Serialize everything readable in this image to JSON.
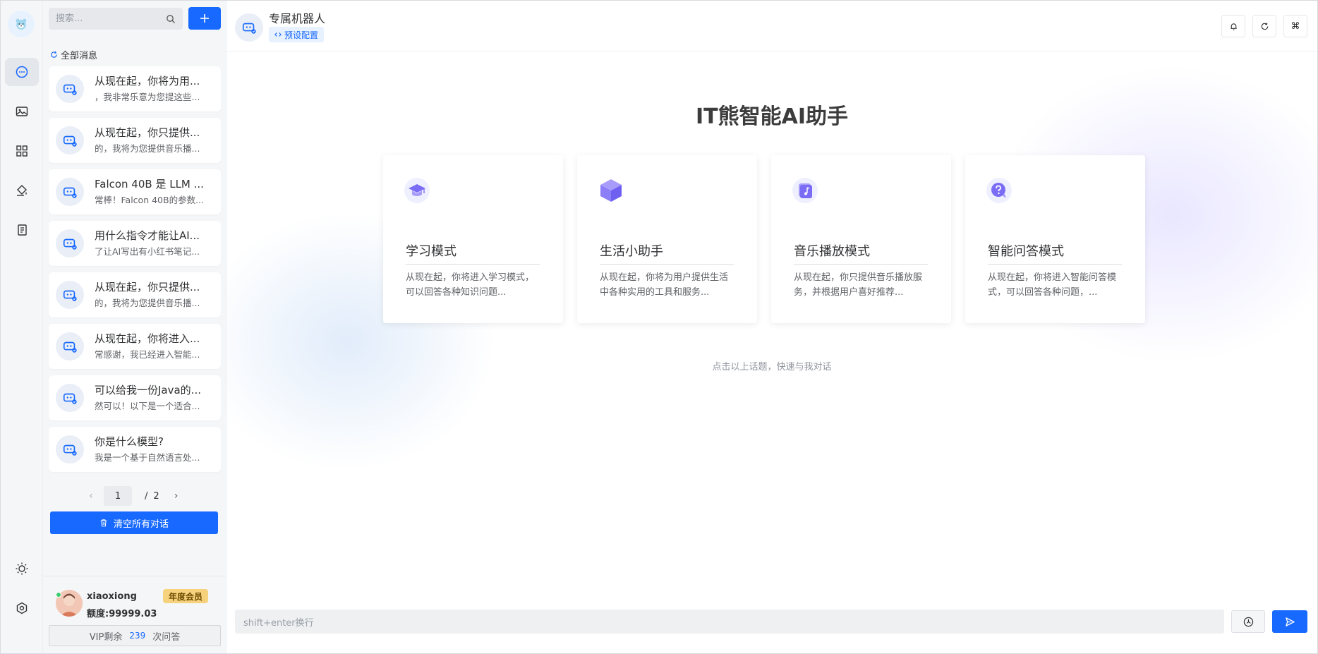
{
  "search": {
    "placeholder": "搜索..."
  },
  "sidebar": {
    "all_messages_label": "全部消息",
    "sessions": [
      {
        "title": "从现在起，你将为用...",
        "preview": "，我非常乐意为您提这些..."
      },
      {
        "title": "从现在起，你只提供...",
        "preview": "的，我将为您提供音乐播..."
      },
      {
        "title": "Falcon 40B 是 LLM ...",
        "preview": "常棒！Falcon 40B的参数..."
      },
      {
        "title": "用什么指令才能让AI...",
        "preview": "了让AI写出有小红书笔记..."
      },
      {
        "title": "从现在起，你只提供...",
        "preview": "的，我将为您提供音乐播..."
      },
      {
        "title": "从现在起，你将进入...",
        "preview": "常感谢，我已经进入智能..."
      },
      {
        "title": "可以给我一份Java的...",
        "preview": "然可以！以下是一个适合..."
      },
      {
        "title": "你是什么模型?",
        "preview": "我是一个基于自然语言处..."
      }
    ],
    "pagination": {
      "current": "1",
      "separator": "/",
      "total": "2"
    },
    "clear_all_label": "清空所有对话",
    "user": {
      "name": "xiaoxiong",
      "quota": "额度:99999.03",
      "membership": "年度会员",
      "vip_remaining_prefix": "VIP剩余",
      "vip_remaining_count": "239",
      "vip_remaining_suffix": "次问答"
    }
  },
  "header": {
    "bot_name": "专属机器人",
    "preset_label": "预设配置",
    "shortcut_symbol": "⌘"
  },
  "main": {
    "title": "IT熊智能AI助手",
    "cards": [
      {
        "title": "学习模式",
        "description": "从现在起，你将进入学习模式，可以回答各种知识问题...",
        "icon": "graduation-cap-icon",
        "color": "#7b6cf6"
      },
      {
        "title": "生活小助手",
        "description": "从现在起，你将为用户提供生活中各种实用的工具和服务...",
        "icon": "cube-icon",
        "color": "#7b6cf6"
      },
      {
        "title": "音乐播放模式",
        "description": "从现在起，你只提供音乐播放服务，并根据用户喜好推荐...",
        "icon": "music-icon",
        "color": "#7b6cf6"
      },
      {
        "title": "智能问答模式",
        "description": "从现在起，你将进入智能问答模式，可以回答各种问题，...",
        "icon": "question-chat-icon",
        "color": "#7b6cf6"
      }
    ],
    "hint": "点击以上话题，快速与我对话"
  },
  "composer": {
    "placeholder": "shift+enter换行"
  },
  "colors": {
    "accent": "#1769ff",
    "vip_badge": "#f7d27c"
  }
}
